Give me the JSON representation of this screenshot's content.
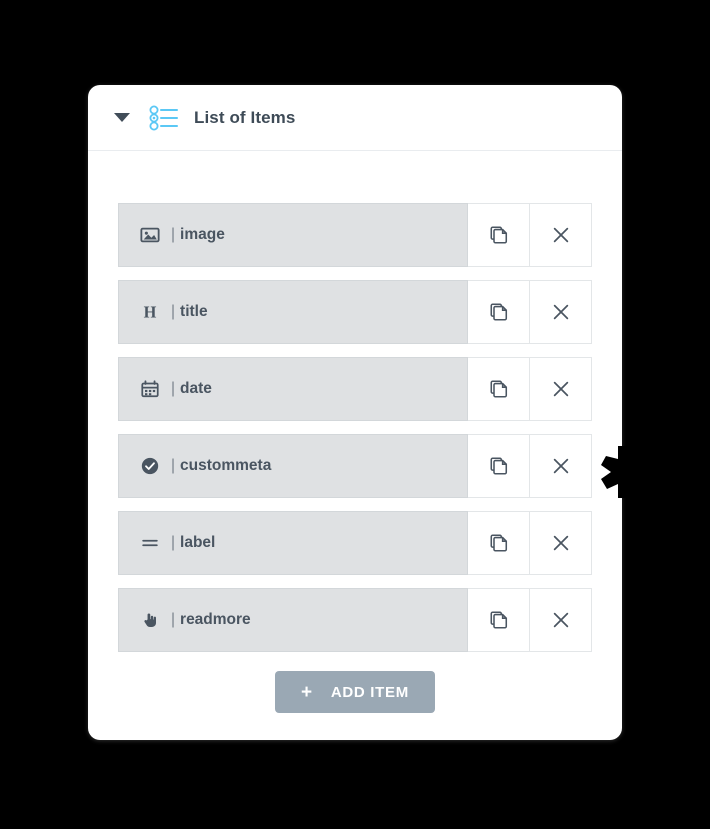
{
  "background_color": "#000000",
  "card": {
    "background_color": "#ffffff",
    "header": {
      "title": "List of Items",
      "collapse_icon": "caret-down-icon",
      "list_icon": "list-bullets-icon",
      "icon_color": "#5bc8f5",
      "title_color": "#3e4b57"
    },
    "rows": [
      {
        "icon": "image-icon",
        "separator": "|",
        "label": "image",
        "duplicate_label": "",
        "delete_label": ""
      },
      {
        "icon": "heading-h-icon",
        "separator": "|",
        "label": "title",
        "duplicate_label": "",
        "delete_label": ""
      },
      {
        "icon": "calendar-icon",
        "separator": "|",
        "label": "date",
        "duplicate_label": "",
        "delete_label": ""
      },
      {
        "icon": "check-circle-icon",
        "separator": "|",
        "label": "custommeta",
        "duplicate_label": "",
        "delete_label": ""
      },
      {
        "icon": "equals-lines-icon",
        "separator": "|",
        "label": "label",
        "duplicate_label": "",
        "delete_label": ""
      },
      {
        "icon": "pointer-hand-icon",
        "separator": "|",
        "label": "readmore",
        "duplicate_label": "",
        "delete_label": ""
      }
    ],
    "row_background_color": "#dfe1e3",
    "row_text_color": "#4a5561",
    "add_button": {
      "plus": "+",
      "label": "ADD ITEM",
      "background_color": "#9aa8b4",
      "text_color": "#ffffff"
    }
  }
}
